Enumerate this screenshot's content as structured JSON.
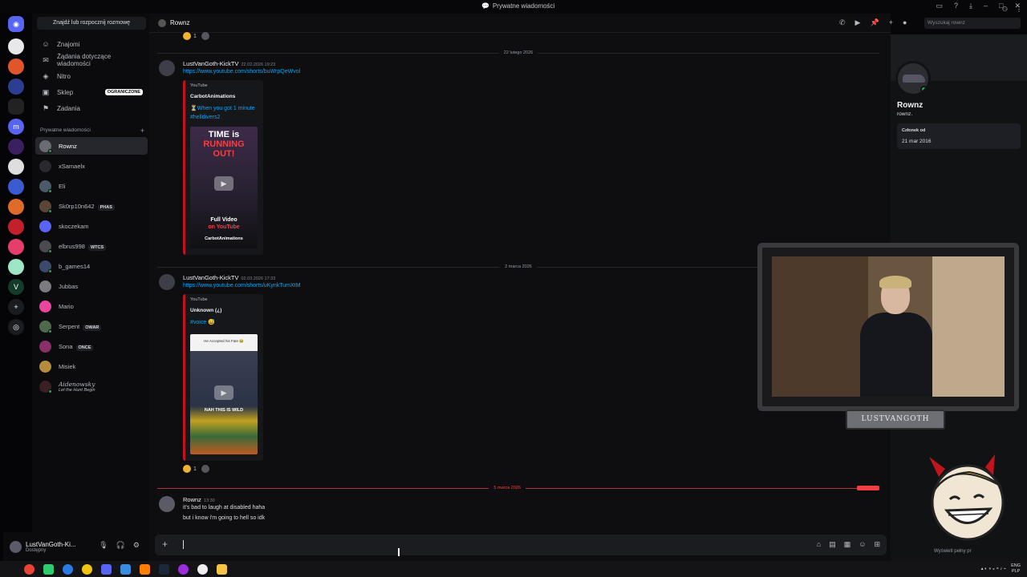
{
  "window": {
    "title": "Prywatne wiadomości"
  },
  "sidebar": {
    "search_label": "Znajdź lub rozpocznij rozmowę",
    "nav": [
      {
        "label": "Znajomi",
        "icon": "friends-icon"
      },
      {
        "label": "Żądania dotyczące wiadomości",
        "icon": "mail-icon"
      },
      {
        "label": "Nitro",
        "icon": "nitro-icon"
      },
      {
        "label": "Sklep",
        "icon": "shop-icon",
        "badge": "OGRANICZONE"
      },
      {
        "label": "Zadania",
        "icon": "quests-icon"
      }
    ],
    "dm_header": "Prywatne wiadomości",
    "dms": [
      {
        "name": "Rownz",
        "active": true,
        "color": "#6b6b74",
        "status": true
      },
      {
        "name": "xSamaelx",
        "color": "#2a2a2e",
        "status": false
      },
      {
        "name": "Eli",
        "color": "#4a5a6a",
        "status": true
      },
      {
        "name": "Sk0rp10n642",
        "tag": "PHAS",
        "color": "#5b4636",
        "status": true
      },
      {
        "name": "skoczekam",
        "color": "#5865f2",
        "status": false
      },
      {
        "name": "elbrus998",
        "tag": "WTCS",
        "color": "#4a4a50",
        "status": true
      },
      {
        "name": "b_games14",
        "color": "#3b4a6b",
        "status": true
      },
      {
        "name": "Jubbas",
        "color": "#7a7a80",
        "status": false
      },
      {
        "name": "Mario",
        "color": "#eb459e",
        "status": false
      },
      {
        "name": "Serpent",
        "tag": "OWAR",
        "color": "#4f6a4a",
        "status": true
      },
      {
        "name": "Sona",
        "tag": "ONCE",
        "color": "#8a2f6a",
        "status": false
      },
      {
        "name": "Misiek",
        "color": "#b58b3e",
        "status": false
      },
      {
        "name": "Aidenowsky",
        "sub": "Let the Hunt Begin",
        "color": "#3a1f24",
        "status": true
      }
    ],
    "user": {
      "name": "LustVanGoth-Ki...",
      "status": "Dostępny"
    }
  },
  "chat": {
    "header_name": "Rownz",
    "search_placeholder": "Wyszukaj rownz",
    "top_reaction_count": "1",
    "dates": [
      "22 lutego 2026",
      "2 marca 2026",
      "5 marca 2026"
    ],
    "new_label": "NOWE",
    "messages": [
      {
        "author": "LustVanGoth-KickTV",
        "time": "22.02.2026 19:23",
        "link": "https://www.youtube.com/shorts/buWrpQeWvol",
        "provider": "YouTube",
        "channel": "CarbotAnimations",
        "title": "⏳When you got 1 minute #helldivers2",
        "thumb_lines": [
          "TIME is",
          "RUNNING",
          "OUT!",
          "Full Video",
          "on YouTube",
          "CarbotAnimations"
        ]
      },
      {
        "author": "LustVanGoth-KickTV",
        "time": "02.03.2026 17:33",
        "link": "https://www.youtube.com/shorts/uKynkTumXtM",
        "provider": "YouTube",
        "channel": "Unknown (¿)",
        "title": "#voice 😅",
        "thumb_lines": [
          "He Accepted his Fate 😂",
          "NAH THIS IS WILD"
        ],
        "reaction_count": "1"
      },
      {
        "author": "Rownz",
        "time": "13:30",
        "lines": [
          "it's bad to laugh at disabled haha",
          "but i know i'm going to hell so idk"
        ]
      }
    ]
  },
  "profile": {
    "name": "Rownz",
    "username": "rownz.",
    "member_label": "Członek od",
    "member_since": "21 mar 2016",
    "footer": "Wyświetl pełny pr"
  },
  "overlay": {
    "cam_tag": "LUSTVANGOTH"
  },
  "taskbar": {
    "lang": "ENG",
    "lang2": "PLP"
  },
  "colors": {
    "accent": "#5865f2",
    "link": "#00a8fc",
    "online": "#23a55a",
    "danger": "#f23f43",
    "embed_border": "#c0131e"
  }
}
